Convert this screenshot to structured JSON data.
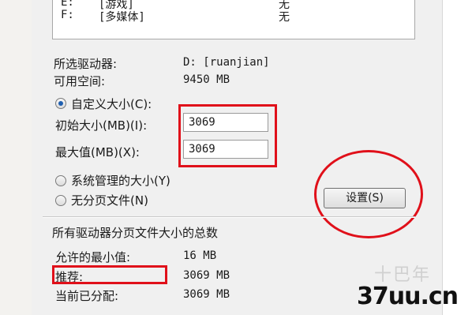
{
  "drives": [
    {
      "letter": "E:",
      "label": "[游戏]",
      "size": "无"
    },
    {
      "letter": "F:",
      "label": "[多媒体]",
      "size": "无"
    }
  ],
  "selected_drive": {
    "label": "所选驱动器:",
    "value": "D:  [ruanjian]",
    "space_label": "可用空间:",
    "space_value": "9450 MB"
  },
  "custom_size": {
    "radio_label": "自定义大小(C):",
    "initial_label": "初始大小(MB)(I):",
    "initial_value": "3069",
    "max_label": "最大值(MB)(X):",
    "max_value": "3069"
  },
  "system_managed": {
    "radio_label": "系统管理的大小(Y)"
  },
  "no_paging": {
    "radio_label": "无分页文件(N)"
  },
  "set_button": {
    "label": "设置(S)"
  },
  "totals": {
    "title": "所有驱动器分页文件大小的总数",
    "min_label": "允许的最小值:",
    "min_value": "16 MB",
    "recommended_label": "推荐:",
    "recommended_value": "3069 MB",
    "current_label": "当前已分配:",
    "current_value": "3069 MB"
  },
  "watermark": {
    "faint": "十巴年",
    "logo": "37uu.cn"
  },
  "colors": {
    "annotation": "#e0101a",
    "radio_dot": "#1f5fb0"
  }
}
